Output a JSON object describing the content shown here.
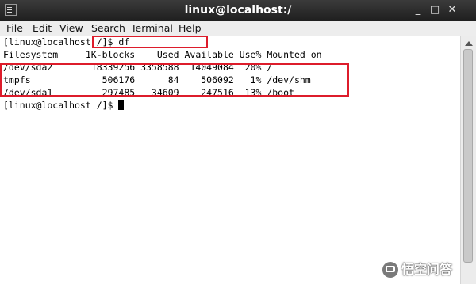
{
  "window": {
    "title": "linux@localhost:/",
    "minimize_label": "_",
    "maximize_label": "□",
    "close_label": "✕"
  },
  "menu": {
    "items": [
      {
        "label": "File"
      },
      {
        "label": "Edit"
      },
      {
        "label": "View"
      },
      {
        "label": "Search"
      },
      {
        "label": "Terminal"
      },
      {
        "label": "Help"
      }
    ]
  },
  "terminal": {
    "lines": [
      "[linux@localhost /]$ df",
      "Filesystem     1K-blocks    Used Available Use% Mounted on",
      "/dev/sda2       18339256 3358588  14049084  20% /",
      "tmpfs             506176      84    506092   1% /dev/shm",
      "/dev/sda1         297485   34609    247516  13% /boot",
      "[linux@localhost /]$ "
    ]
  },
  "annotation_color": "#dd1c2b",
  "watermark": {
    "text": "悟空问答",
    "icon": "chat-bubble-icon"
  }
}
